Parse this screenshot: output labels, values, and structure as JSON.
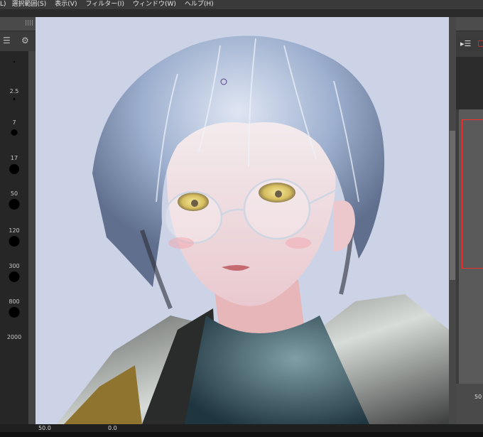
{
  "menu": {
    "items": [
      "L)",
      "選択範囲(S)",
      "表示(V)",
      "フィルター(I)",
      "ウィンドウ(W)",
      "ヘルプ(H)"
    ]
  },
  "brush_sizes": [
    {
      "label": ""
    },
    {
      "label": "2.5"
    },
    {
      "label": "7"
    },
    {
      "label": "17"
    },
    {
      "label": "50"
    },
    {
      "label": "120"
    },
    {
      "label": "300"
    },
    {
      "label": "800"
    },
    {
      "label": "2000"
    }
  ],
  "status": {
    "zoom": "50.0",
    "angle": "0.0"
  },
  "right_panel": {
    "bottom_value": "50"
  },
  "colors": {
    "canvas_bg": "#cdd3e6",
    "hair": "#9eb0cf",
    "eyes": "#d7c23a",
    "jacket": "#3a3d3c",
    "shirt": "#2f4b58",
    "accent_red": "#ff3030"
  }
}
